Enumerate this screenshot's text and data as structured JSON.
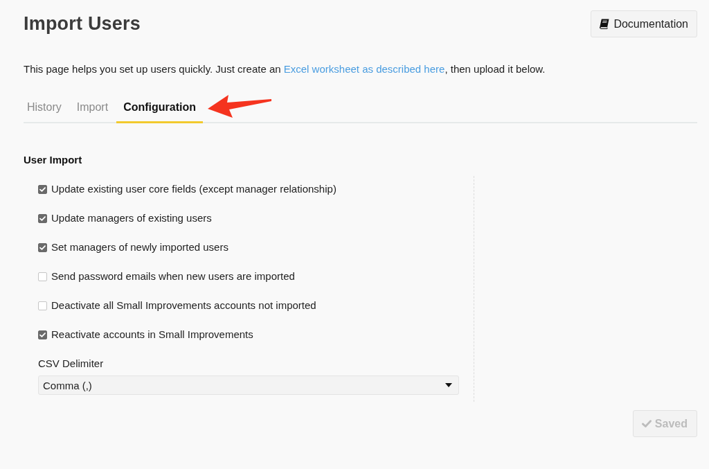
{
  "header": {
    "title": "Import Users",
    "documentation_button": "Documentation"
  },
  "intro": {
    "before": "This page helps you set up users quickly. Just create an ",
    "link": "Excel worksheet as described here",
    "after": ", then upload it below."
  },
  "tabs": [
    {
      "label": "History",
      "selected": false
    },
    {
      "label": "Import",
      "selected": false
    },
    {
      "label": "Configuration",
      "selected": true
    }
  ],
  "user_import": {
    "title": "User Import",
    "options": [
      {
        "label": "Update existing user core fields (except manager relationship)",
        "checked": true
      },
      {
        "label": "Update managers of existing users",
        "checked": true
      },
      {
        "label": "Set managers of newly imported users",
        "checked": true
      },
      {
        "label": "Send password emails when new users are imported",
        "checked": false
      },
      {
        "label": "Deactivate all Small Improvements accounts not imported",
        "checked": false
      },
      {
        "label": "Reactivate accounts in Small Improvements",
        "checked": true
      }
    ],
    "csv_delimiter": {
      "label": "CSV Delimiter",
      "value": "Comma (,)"
    }
  },
  "save_button": {
    "label": "Saved",
    "disabled": true
  }
}
